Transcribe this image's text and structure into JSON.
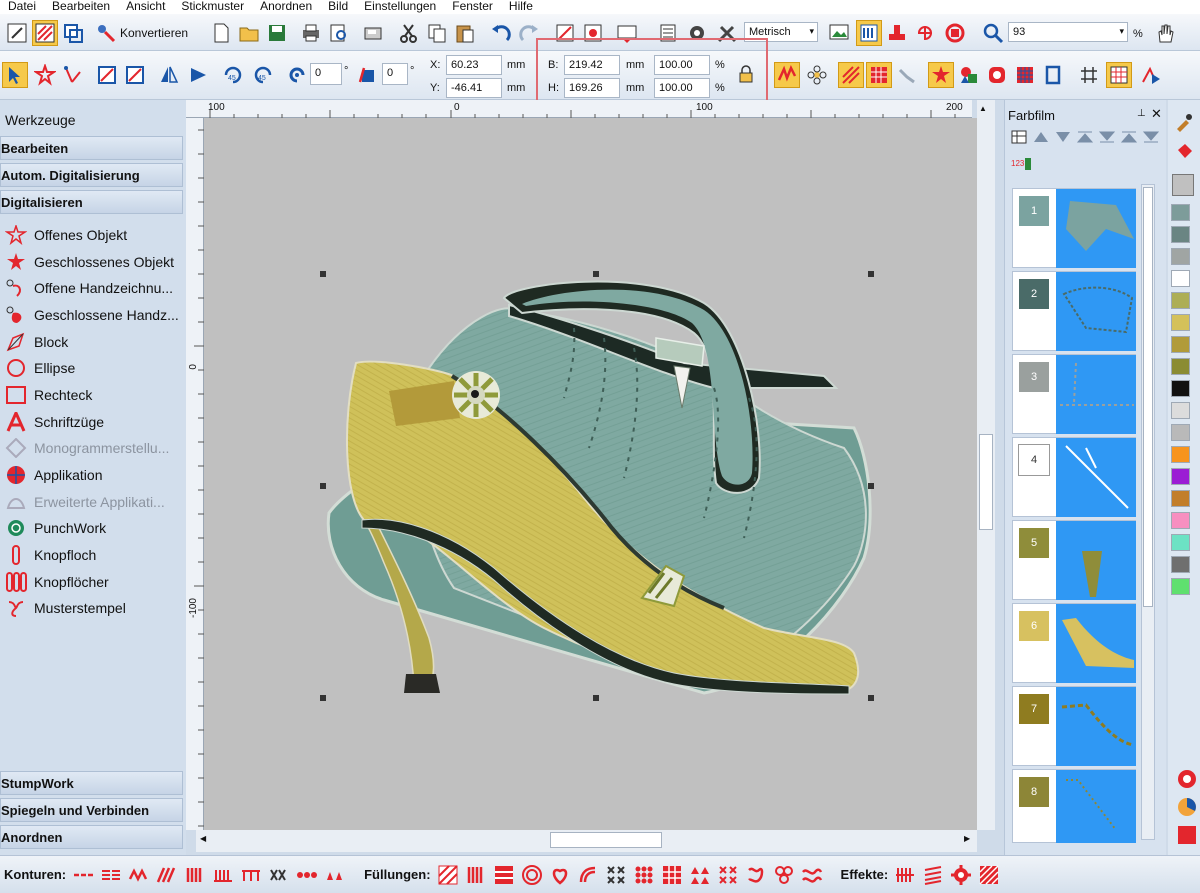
{
  "menu": [
    "Datei",
    "Bearbeiten",
    "Ansicht",
    "Stickmuster",
    "Anordnen",
    "Bild",
    "Einstellungen",
    "Fenster",
    "Hilfe"
  ],
  "toolbar1": {
    "konvertieren_label": "Konvertieren",
    "units_value": "Metrisch",
    "zoom_value": "93",
    "zoom_unit": "%"
  },
  "toolbar2": {
    "rotate_value": "0",
    "rotate_unit": "°",
    "slant_value": "0",
    "slant_unit": "°",
    "x_label": "X:",
    "x_value": "60.23",
    "y_label": "Y:",
    "y_value": "-46.41",
    "xy_unit": "mm",
    "b_label": "B:",
    "b_value": "219.42",
    "h_label": "H:",
    "h_value": "169.26",
    "bh_unit": "mm",
    "b_pct": "100.00",
    "h_pct": "100.00",
    "pct_unit": "%"
  },
  "left_panel": {
    "title": "Werkzeuge",
    "headers": [
      "Bearbeiten",
      "Autom. Digitalisierung",
      "Digitalisieren"
    ],
    "tools": [
      {
        "label": "Offenes Objekt",
        "icon": "open-star-icon"
      },
      {
        "label": "Geschlossenes Objekt",
        "icon": "closed-star-icon"
      },
      {
        "label": "Offene Handzeichnu...",
        "icon": "freehand-open-icon"
      },
      {
        "label": "Geschlossene Handz...",
        "icon": "freehand-closed-icon"
      },
      {
        "label": "Block",
        "icon": "block-icon"
      },
      {
        "label": "Ellipse",
        "icon": "ellipse-icon"
      },
      {
        "label": "Rechteck",
        "icon": "rectangle-icon"
      },
      {
        "label": "Schriftzüge",
        "icon": "lettering-icon"
      },
      {
        "label": "Monogrammerstellu...",
        "icon": "monogram-icon"
      },
      {
        "label": "Applikation",
        "icon": "applique-icon"
      },
      {
        "label": "Erweiterte Applikati...",
        "icon": "advanced-applique-icon"
      },
      {
        "label": "PunchWork",
        "icon": "punchwork-icon"
      },
      {
        "label": "Knopfloch",
        "icon": "buttonhole-icon"
      },
      {
        "label": "Knopflöcher",
        "icon": "buttonholes-icon"
      },
      {
        "label": "Musterstempel",
        "icon": "pattern-stamp-icon"
      }
    ],
    "bottom_headers": [
      "StumpWork",
      "Spiegeln und Verbinden",
      "Anordnen"
    ]
  },
  "ruler": {
    "top_labels": [
      "100",
      "0",
      "100",
      "200"
    ],
    "left_labels": [
      "0",
      "-100"
    ]
  },
  "farbfilm": {
    "title": "Farbfilm",
    "items": [
      {
        "num": "1",
        "color": "#7ba3a0"
      },
      {
        "num": "2",
        "color": "#4a6b68"
      },
      {
        "num": "3",
        "color": "#9aa09e"
      },
      {
        "num": "4",
        "color": "#ffffff"
      },
      {
        "num": "5",
        "color": "#8f8d3a"
      },
      {
        "num": "6",
        "color": "#d7c160"
      },
      {
        "num": "7",
        "color": "#8f7c20"
      },
      {
        "num": "8",
        "color": "#8d8637"
      }
    ]
  },
  "palette": [
    "#7d9c9a",
    "#6a8583",
    "#a0a5a3",
    "#ffffff",
    "#adae55",
    "#d4c15a",
    "#b19b3a",
    "#8b8c33",
    "#111111",
    "#dcdcdc",
    "#b9b9b9",
    "#f7941d",
    "#9b1dd4",
    "#c27e2a",
    "#f78fc0",
    "#6ce2c4",
    "#6f6f6f",
    "#5fe06f"
  ],
  "bottom_bar": {
    "konturen_label": "Konturen:",
    "fuellungen_label": "Füllungen:",
    "effekte_label": "Effekte:"
  },
  "colors": {
    "accent": "#e3262d",
    "highlight": "#e06a72",
    "farbfilm_bg": "#2f98f4"
  }
}
